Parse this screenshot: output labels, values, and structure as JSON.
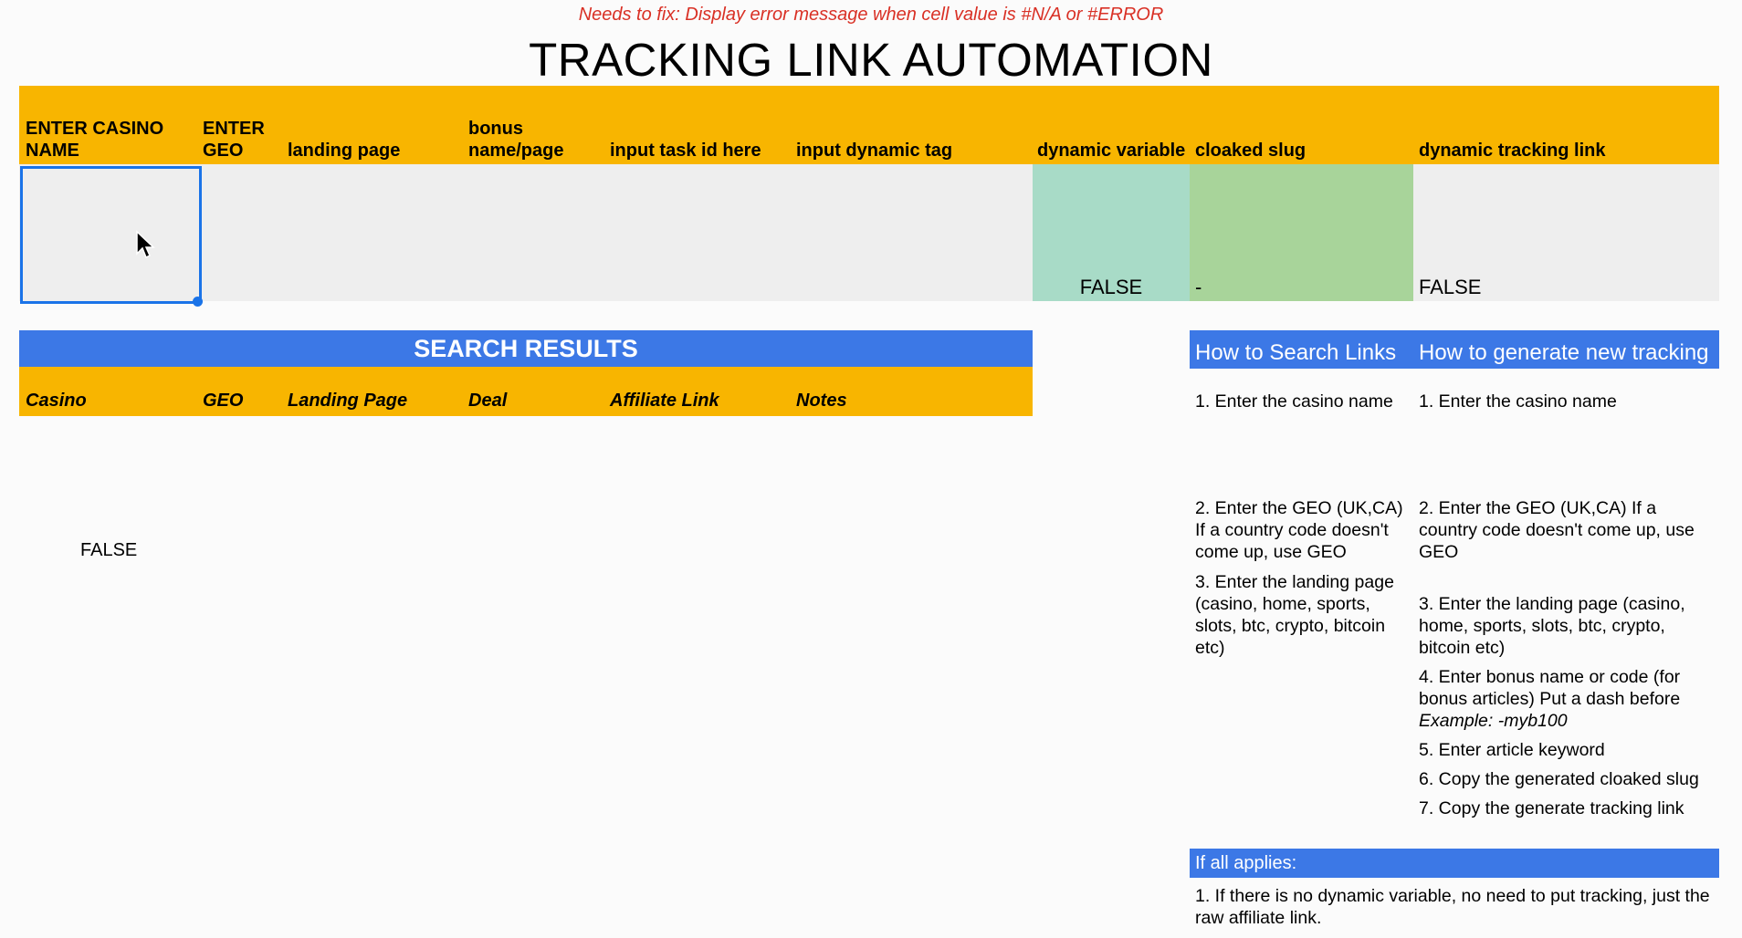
{
  "notice": "Needs to fix: Display error message when cell value is #N/A or #ERROR",
  "title": "TRACKING LINK AUTOMATION",
  "headers": {
    "casino": "ENTER CASINO NAME",
    "geo": "ENTER GEO",
    "landing": "landing page",
    "bonus": "bonus name/page",
    "task": "input task id here",
    "tag": "input dynamic tag",
    "dynvar": "dynamic variable",
    "slug": "cloaked slug",
    "link": "dynamic tracking link"
  },
  "input_row": {
    "dynvar_value": "FALSE",
    "slug_value": "-",
    "link_value": "FALSE"
  },
  "search_results": {
    "title": "SEARCH RESULTS",
    "columns": [
      "Casino",
      "GEO",
      "Landing Page",
      "Deal",
      "Affiliate Link",
      "Notes"
    ],
    "cell_value": "FALSE"
  },
  "how_search": {
    "title": "How to Search Links",
    "steps": [
      "1. Enter the casino name",
      "2. Enter the GEO (UK,CA) If a country code doesn't come up, use GEO",
      "3. Enter the landing page (casino, home, sports, slots, btc, crypto, bitcoin etc)"
    ]
  },
  "how_generate": {
    "title": "How to generate new tracking",
    "steps": [
      "1. Enter the casino name",
      "2. Enter the GEO (UK,CA) If a country code doesn't come up, use GEO",
      "3. Enter the landing page (casino, home, sports, slots, btc, crypto, bitcoin etc)",
      "4. Enter bonus name or code (for bonus articles) Put a dash before",
      "Example: -myb100",
      "5. Enter article keyword",
      "6. Copy the generated cloaked slug",
      "7. Copy the generate tracking link"
    ]
  },
  "applies": {
    "title": "If all applies:",
    "text": "1. If there is no dynamic variable, no need to put tracking, just the raw affiliate link."
  }
}
